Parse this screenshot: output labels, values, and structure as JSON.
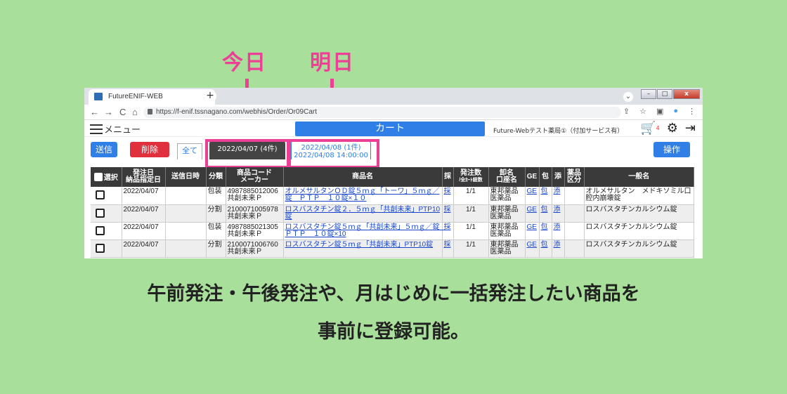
{
  "callouts": {
    "today": "今日",
    "tomorrow": "明日"
  },
  "browser": {
    "tab_title": "FutureENIF-WEB",
    "tab_close": "×",
    "new_tab": "+",
    "url": "https://f-enif.tssnagano.com/webhis/Order/Or09Cart",
    "nav": {
      "back": "←",
      "forward": "→",
      "reload": "C",
      "home": "⌂"
    }
  },
  "app": {
    "menu_label": "メニュー",
    "cart_button": "カート",
    "store_name": "Future-Webテスト薬局①（付加サービス有）",
    "cart_badge": "4"
  },
  "toolbar": {
    "send_label": "送信",
    "delete_label": "削除",
    "operate_label": "操作",
    "filter_all": "全て",
    "filter_today": "2022/04/07 (4件)",
    "filter_tomorrow_line1": "2022/04/08 (1件)",
    "filter_tomorrow_line2": "2022/04/08 14:00:00"
  },
  "table": {
    "headers": {
      "select": "選択",
      "order_date_1": "発注日",
      "order_date_2": "納品指定日",
      "sent_time": "送信日時",
      "split": "分類",
      "code_maker_1": "商品コード",
      "code_maker_2": "メーカー",
      "product": "商品名",
      "adopt": "採",
      "qty_1": "発注数",
      "qty_2": "/全ｶｰﾄ総数",
      "wholesale_1": "卸名",
      "wholesale_2": "口座名",
      "ge": "GE",
      "pack": "包",
      "add": "添",
      "drug_1": "薬品",
      "drug_2": "区分",
      "generic": "一般名"
    },
    "rows": [
      {
        "date": "2022/04/07",
        "type": "包装",
        "code": "4987885012006",
        "maker": "共創未来Ｐ",
        "name": "オルメサルタンＯＤ錠５ｍｇ「トーワ」５ｍｇ／錠　ＰＴＰ　１０錠×１０",
        "adopt": "採",
        "qty": "1/1",
        "ws1": "東邦薬品",
        "ws2": "医薬品",
        "ge": "GE",
        "pack": "包",
        "add": "添",
        "generic": "オルメサルタン　メドキソミル口腔内崩壊錠"
      },
      {
        "date": "2022/04/07",
        "type": "分割",
        "code": "2100071005978",
        "maker": "共創未来Ｐ",
        "name": "ロスバスタチン錠２．５ｍｇ「共創未来」PTP10錠",
        "adopt": "採",
        "qty": "1/1",
        "ws1": "東邦薬品",
        "ws2": "医薬品",
        "ge": "GE",
        "pack": "包",
        "add": "添",
        "generic": "ロスバスタチンカルシウム錠"
      },
      {
        "date": "2022/04/07",
        "type": "包装",
        "code": "4987885021305",
        "maker": "共創未来Ｐ",
        "name": "ロスバスタチン錠５ｍｇ「共創未来」５ｍｇ／錠　ＰＴＰ　１０錠×10",
        "adopt": "採",
        "qty": "1/1",
        "ws1": "東邦薬品",
        "ws2": "医薬品",
        "ge": "GE",
        "pack": "包",
        "add": "添",
        "generic": "ロスバスタチンカルシウム錠"
      },
      {
        "date": "2022/04/07",
        "type": "分割",
        "code": "2100071006760",
        "maker": "共創未来Ｐ",
        "name": "ロスバスタチン錠５ｍｇ「共創未来」PTP10錠",
        "adopt": "採",
        "qty": "1/1",
        "ws1": "東邦薬品",
        "ws2": "医薬品",
        "ge": "GE",
        "pack": "包",
        "add": "添",
        "generic": "ロスバスタチンカルシウム錠"
      }
    ]
  },
  "caption": {
    "line1": "午前発注・午後発注や、月はじめに一括発注したい商品を",
    "line2": "事前に登録可能。"
  },
  "colors": {
    "accent_pink": "#ee3f97",
    "primary_blue": "#2f7fe6",
    "danger_red": "#e0303e",
    "background": "#a8df9a"
  }
}
